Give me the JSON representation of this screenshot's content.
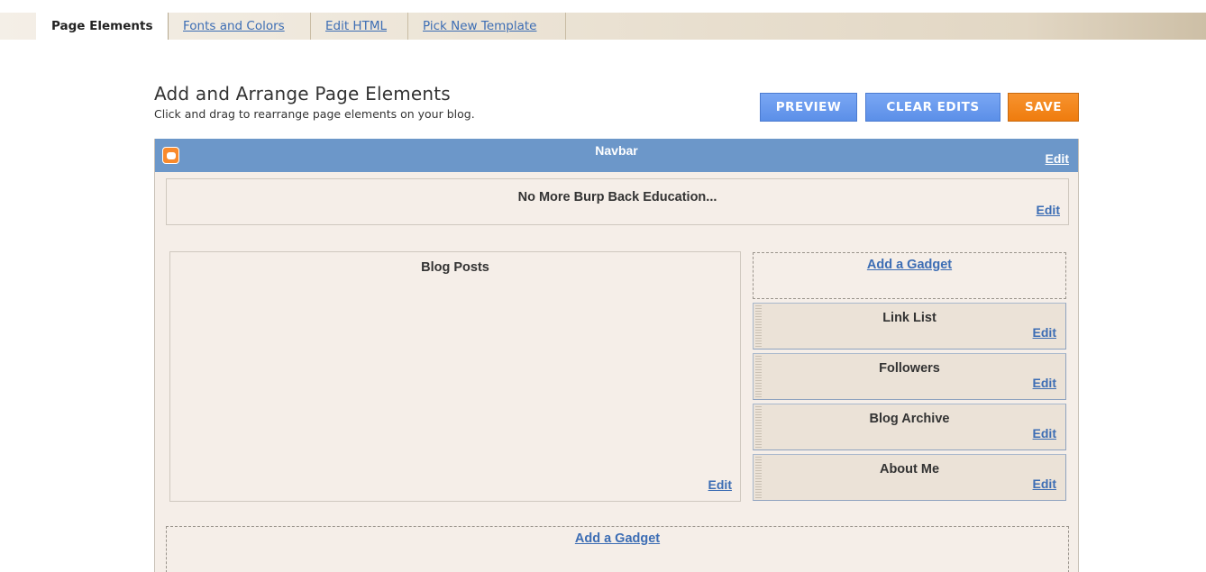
{
  "tabs": {
    "page_elements": "Page Elements",
    "fonts_colors": "Fonts and Colors",
    "edit_html": "Edit HTML",
    "pick_template": "Pick New Template"
  },
  "header": {
    "title": "Add and Arrange Page Elements",
    "subtitle": "Click and drag to rearrange page elements on your blog."
  },
  "buttons": {
    "preview": "PREVIEW",
    "clear_edits": "CLEAR EDITS",
    "save": "SAVE"
  },
  "navbar": {
    "title": "Navbar",
    "edit": "Edit"
  },
  "blog_header": {
    "title": "No More Burp Back Education...",
    "edit": "Edit"
  },
  "main": {
    "title": "Blog Posts",
    "edit": "Edit"
  },
  "sidebar": {
    "add_gadget": "Add a Gadget",
    "widgets": [
      {
        "title": "Link List",
        "edit": "Edit"
      },
      {
        "title": "Followers",
        "edit": "Edit"
      },
      {
        "title": "Blog Archive",
        "edit": "Edit"
      },
      {
        "title": "About Me",
        "edit": "Edit"
      }
    ]
  },
  "footer": {
    "add_gadget": "Add a Gadget"
  },
  "colors": {
    "navbar_blue": "#6c97c9",
    "button_blue": "#6b9cf0",
    "save_orange": "#f38a1e",
    "link_blue": "#3c6db4",
    "layout_bg": "#f5eee8"
  }
}
